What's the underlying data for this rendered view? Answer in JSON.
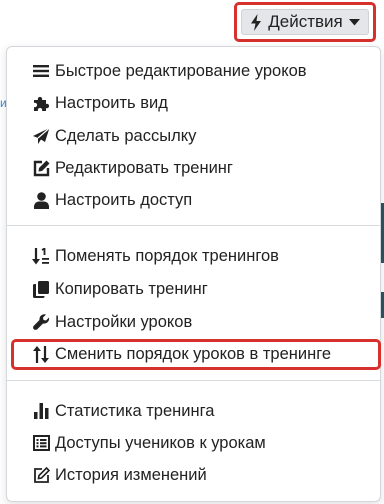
{
  "header": {
    "actions_label": "Действия"
  },
  "background": {
    "fragment_text": "ия"
  },
  "menu": {
    "groups": [
      {
        "items": [
          {
            "label": "Быстрое редактирование уроков",
            "icon": "list-icon"
          },
          {
            "label": "Настроить вид",
            "icon": "puzzle-icon"
          },
          {
            "label": "Сделать рассылку",
            "icon": "send-icon"
          },
          {
            "label": "Редактировать тренинг",
            "icon": "edit-icon"
          },
          {
            "label": "Настроить доступ",
            "icon": "user-icon"
          }
        ]
      },
      {
        "items": [
          {
            "label": "Поменять порядок тренингов",
            "icon": "sort-numeric-icon"
          },
          {
            "label": "Копировать тренинг",
            "icon": "copy-icon"
          },
          {
            "label": "Настройки уроков",
            "icon": "wrench-icon"
          },
          {
            "label": "Сменить порядок уроков в тренинге",
            "icon": "swap-vertical-icon"
          }
        ]
      },
      {
        "items": [
          {
            "label": "Статистика тренинга",
            "icon": "bar-chart-icon"
          },
          {
            "label": "Доступы учеников к урокам",
            "icon": "table-list-icon"
          },
          {
            "label": "История изменений",
            "icon": "edit-outline-icon"
          }
        ]
      }
    ]
  },
  "colors": {
    "highlight": "#d6312c",
    "button_bg": "#e4e6e9",
    "text": "#222222",
    "link": "#3a8fd6"
  }
}
